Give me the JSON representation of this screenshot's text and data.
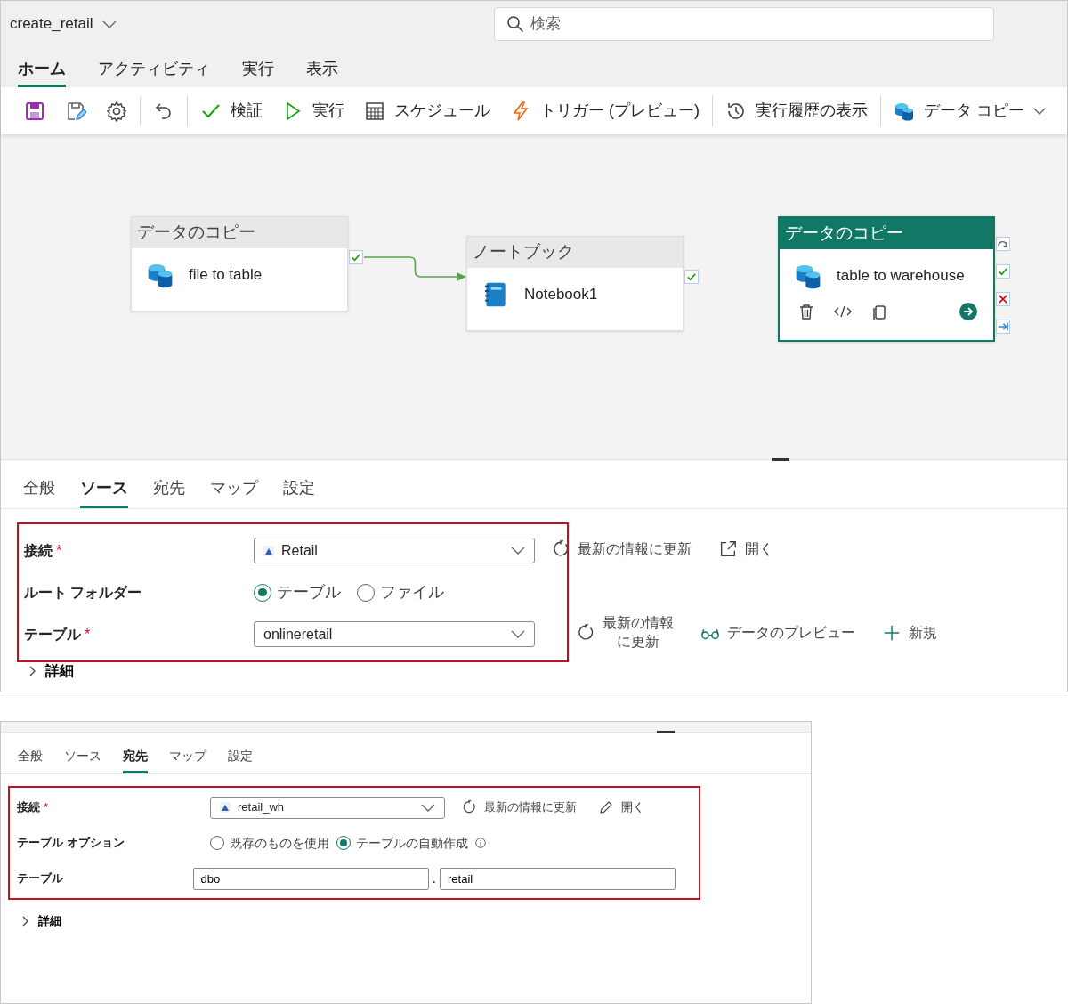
{
  "window": {
    "title": "create_retail",
    "search": {
      "placeholder": "検索"
    }
  },
  "menu_tabs": [
    {
      "label": "ホーム",
      "selected": true
    },
    {
      "label": "アクティビティ",
      "selected": false
    },
    {
      "label": "実行",
      "selected": false
    },
    {
      "label": "表示",
      "selected": false
    }
  ],
  "toolbar": {
    "groups": [
      {
        "items": [
          {
            "kind": "save"
          },
          {
            "kind": "save-edit"
          },
          {
            "kind": "gear"
          }
        ]
      },
      {
        "items": [
          {
            "kind": "undo"
          }
        ]
      },
      {
        "items": [
          {
            "kind": "check",
            "label": "検証"
          },
          {
            "kind": "play",
            "label": "実行"
          },
          {
            "kind": "calendar",
            "label": "スケジュール"
          },
          {
            "kind": "bolt",
            "label": "トリガー (プレビュー)"
          }
        ]
      },
      {
        "items": [
          {
            "kind": "history",
            "label": "実行履歴の表示"
          }
        ]
      },
      {
        "items": [
          {
            "kind": "database",
            "label": "データ コピー",
            "dropdown": true
          }
        ]
      }
    ]
  },
  "canvas": {
    "activities": [
      {
        "type": "データのコピー",
        "name": "file to table",
        "kind": "database",
        "selected": false,
        "linked_to_next": true,
        "ports": [
          {
            "kind": "success"
          }
        ]
      },
      {
        "type": "ノートブック",
        "name": "Notebook1",
        "kind": "notebook",
        "selected": false,
        "linked_to_next": false,
        "ports": [
          {
            "kind": "success"
          }
        ]
      },
      {
        "type": "データのコピー",
        "name": "table to warehouse",
        "kind": "database",
        "selected": true,
        "linked_to_next": false,
        "ports": [
          {
            "kind": "skip"
          },
          {
            "kind": "success"
          },
          {
            "kind": "fail"
          },
          {
            "kind": "complete"
          }
        ]
      }
    ]
  },
  "source_panel": {
    "tabs": [
      {
        "label": "全般",
        "selected": false
      },
      {
        "label": "ソース",
        "selected": true
      },
      {
        "label": "宛先",
        "selected": false
      },
      {
        "label": "マップ",
        "selected": false
      },
      {
        "label": "設定",
        "selected": false
      }
    ],
    "fields": [
      {
        "label": "接続",
        "required_mark": "*",
        "kind": "dropdown",
        "value": "Retail",
        "actions": [
          {
            "kind": "refresh",
            "label": "最新の情報に更新"
          },
          {
            "kind": "open",
            "label": "開く"
          }
        ]
      },
      {
        "label": "ルート フォルダー",
        "kind": "radio",
        "options": [
          {
            "label": "テーブル",
            "selected": true
          },
          {
            "label": "ファイル",
            "selected": false
          }
        ]
      },
      {
        "label": "テーブル",
        "required_mark": "*",
        "kind": "dropdown",
        "value": "onlineretail",
        "actions": [
          {
            "kind": "refresh",
            "label": "最新の情報に更新"
          },
          {
            "kind": "glasses",
            "label": "データのプレビュー"
          },
          {
            "kind": "plus",
            "label": "新規"
          }
        ]
      }
    ],
    "details": {
      "label": "詳細",
      "expanded": false
    }
  },
  "destination_panel": {
    "tabs": [
      {
        "label": "全般",
        "selected": false
      },
      {
        "label": "ソース",
        "selected": false
      },
      {
        "label": "宛先",
        "selected": true
      },
      {
        "label": "マップ",
        "selected": false
      },
      {
        "label": "設定",
        "selected": false
      }
    ],
    "fields": [
      {
        "label": "接続",
        "required_mark": "*",
        "kind": "dropdown",
        "value": "retail_wh",
        "actions": [
          {
            "kind": "refresh",
            "label": "最新の情報に更新"
          },
          {
            "kind": "pencil",
            "label": "開く"
          }
        ]
      },
      {
        "label": "テーブル オプション",
        "kind": "radio",
        "options": [
          {
            "label": "既存のものを使用",
            "selected": false
          },
          {
            "label": "テーブルの自動作成",
            "selected": true,
            "info": true
          }
        ]
      },
      {
        "label": "テーブル",
        "kind": "text-pair",
        "values": [
          "dbo",
          "retail"
        ],
        "separator": "."
      }
    ],
    "details": {
      "label": "詳細",
      "expanded": false
    }
  }
}
